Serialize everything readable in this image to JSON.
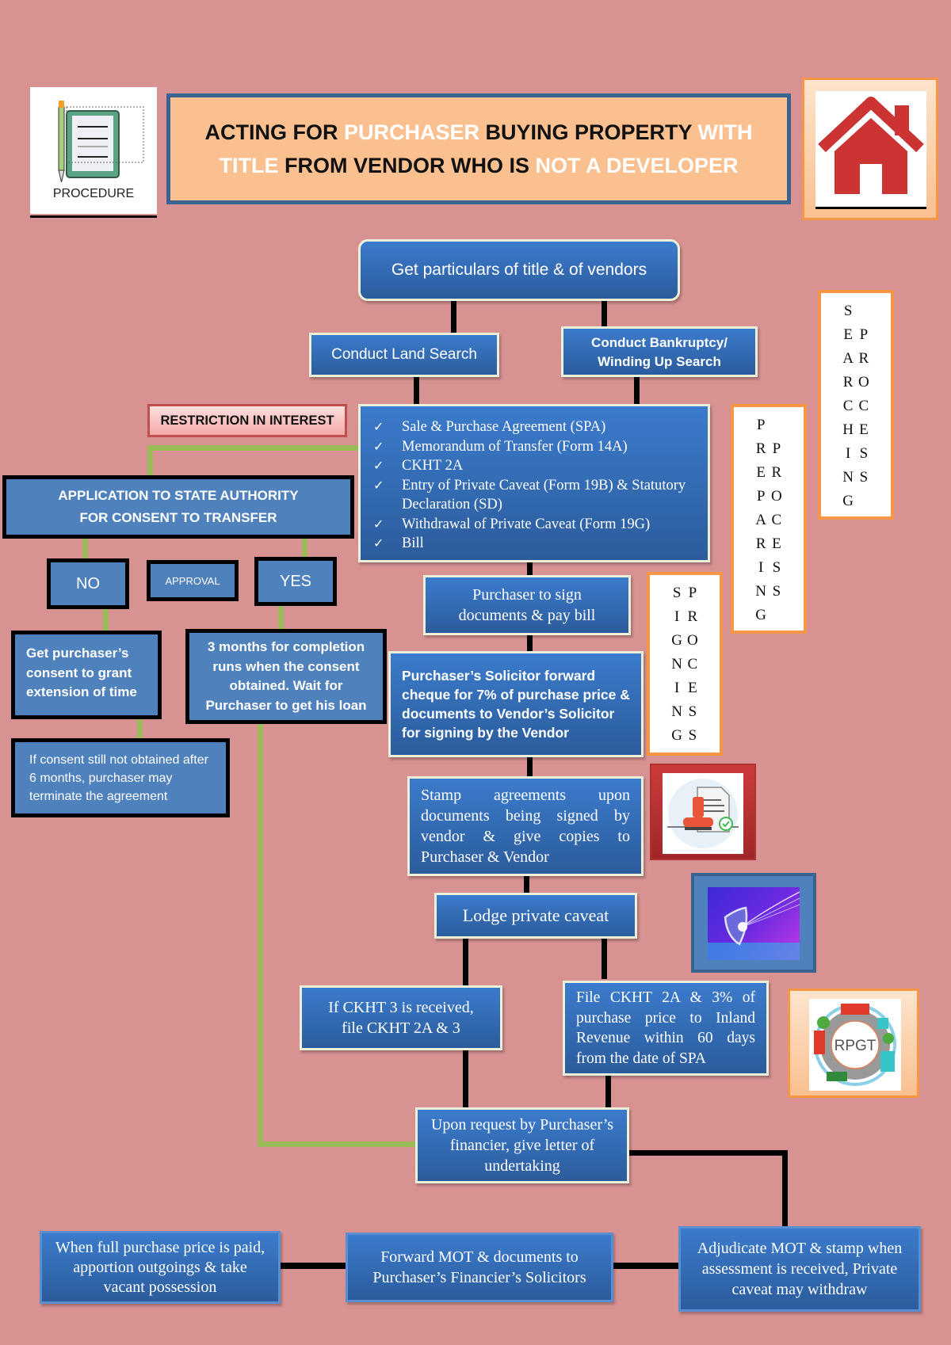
{
  "header": {
    "procedure_icon_label": "PROCEDURE",
    "title_line1": [
      {
        "text": "ACTING FOR ",
        "highlight": false
      },
      {
        "text": "PURCHASER",
        "highlight": true
      },
      {
        "text": " BUYING PROPERTY ",
        "highlight": false
      },
      {
        "text": "WITH",
        "highlight": true
      }
    ],
    "title_line2": [
      {
        "text": "TITLE",
        "highlight": true
      },
      {
        "text": " FROM VENDOR WHO IS ",
        "highlight": false
      },
      {
        "text": "NOT A DEVELOPER",
        "highlight": true
      }
    ]
  },
  "colors": {
    "background": "#d89292",
    "node_blue": "#3b7bcc",
    "flat_blue": "#4f81bd",
    "connector_green": "#9bbb59",
    "accent_orange": "#f79646",
    "title_fill": "#fac090",
    "house_red": "#cc3333"
  },
  "flow": {
    "get_particulars": "Get particulars of title & of vendors",
    "land_search": "Conduct Land Search",
    "bankruptcy_search_l1": "Conduct Bankruptcy/",
    "bankruptcy_search_l2": "Winding Up Search",
    "documents": [
      "Sale & Purchase Agreement (SPA)",
      "Memorandum of Transfer (Form 14A)",
      "CKHT 2A",
      "Entry of Private Caveat (Form 19B) & Statutory  Declaration (SD)",
      "Withdrawal of Private Caveat (Form 19G)",
      "Bill"
    ],
    "sign_pay": "Purchaser to sign documents & pay bill",
    "forward_cheque": "Purchaser’s Solicitor forward cheque for 7% of purchase price & documents to Vendor’s Solicitor for signing by the Vendor",
    "stamp_agreements": "Stamp agreements upon documents being signed by vendor & give copies to Purchaser & Vendor",
    "lodge_caveat": "Lodge private caveat",
    "ckht3_received": "If CKHT 3 is received, file CKHT 2A & 3",
    "file_ckht2a": "File CKHT 2A & 3% of purchase price to Inland Revenue within 60 days from the date of SPA",
    "letter_undertaking": "Upon request by Purchaser’s financier, give letter of undertaking",
    "adjudicate": "Adjudicate MOT & stamp when assessment is received, Private caveat may withdraw",
    "forward_mot": "Forward MOT & documents to Purchaser’s Financier’s Solicitors",
    "full_price_paid": "When full purchase price is paid, apportion outgoings & take vacant possession"
  },
  "restriction": {
    "label": "RESTRICTION IN INTEREST",
    "application_l1": "APPLICATION TO STATE AUTHORITY",
    "application_l2": "FOR CONSENT TO TRANSFER",
    "no": "NO",
    "approval": "APPROVAL",
    "yes": "YES",
    "extension": "Get purchaser’s consent to grant extension of time",
    "three_months": "3 months for completion runs when the consent obtained. Wait for Purchaser to get his loan",
    "terminate": "If consent still not obtained after 6 months, purchaser may terminate the agreement"
  },
  "side_labels": {
    "searching": {
      "col1": [
        "S",
        "E",
        "A",
        "R",
        "C",
        "H",
        "I",
        "N",
        "G"
      ],
      "col2": [
        "",
        "P",
        "R",
        "O",
        "C",
        "E",
        "S",
        "S"
      ]
    },
    "preparing": {
      "col1": [
        "P",
        "R",
        "E",
        "P",
        "A",
        "R",
        "I",
        "N",
        "G"
      ],
      "col2": [
        "",
        "P",
        "R",
        "O",
        "C",
        "E",
        "S",
        "S"
      ]
    },
    "signing": {
      "col1": [
        "S",
        "I",
        "G",
        "N",
        "I",
        "N",
        "G"
      ],
      "col2": [
        "P",
        "R",
        "O",
        "C",
        "E",
        "S",
        "S"
      ]
    }
  },
  "images": {
    "rpgt_label": "RPGT"
  }
}
